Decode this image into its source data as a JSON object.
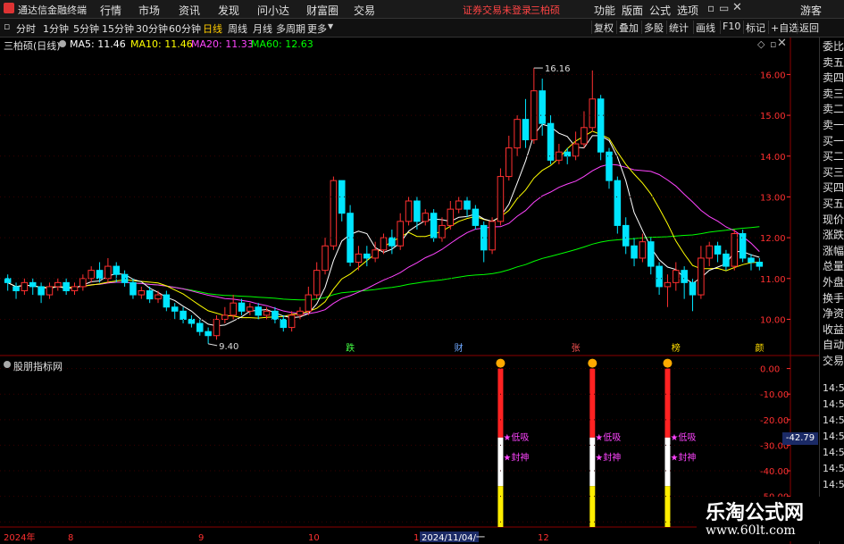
{
  "app": {
    "name": "通达信金融终端"
  },
  "menu": [
    "行情",
    "市场",
    "资讯",
    "发现",
    "问小达",
    "财富圈",
    "交易"
  ],
  "notice": "证券交易未登录",
  "stock_name_top": "三柏硕",
  "top_right": [
    "功能",
    "版面",
    "公式",
    "选项",
    "画线",
    "游客"
  ],
  "timeframes": [
    "分时",
    "1分钟",
    "5分钟",
    "15分钟",
    "30分钟",
    "60分钟",
    "日线",
    "周线",
    "月线",
    "多周期",
    "更多"
  ],
  "active_timeframe": "日线",
  "right_toolbar": [
    "复权",
    "叠加",
    "多股",
    "统计",
    "画线",
    "F10",
    "标记",
    "+自选",
    "返回"
  ],
  "chart_header": {
    "title": "三柏硕(日线)",
    "ma": [
      {
        "label": "MA5: 11.46",
        "color": "#ffffff"
      },
      {
        "label": "MA10: 11.46",
        "color": "#ffff00"
      },
      {
        "label": "MA20: 11.33",
        "color": "#ff44ff"
      },
      {
        "label": "MA60: 12.63",
        "color": "#00ff00"
      }
    ]
  },
  "side_panel": [
    "委比",
    "卖五",
    "卖四",
    "卖三",
    "卖二",
    "卖一",
    "买一",
    "买二",
    "买三",
    "买四",
    "买五",
    "现价",
    "涨跌",
    "涨幅",
    "总量",
    "外盘",
    "换手",
    "净资",
    "收益",
    "自动",
    "交易"
  ],
  "side_times": [
    "14:56",
    "14:56",
    "14:56",
    "14:56",
    "14:56",
    "14:56",
    "14:56"
  ],
  "indicator_title": "股朋指标网",
  "indicator_value": "-42.79",
  "annotations": {
    "high": "16.16",
    "low": "9.40"
  },
  "signal_labels": {
    "buy": "低吸",
    "seal": "封神"
  },
  "event_marks": [
    "跌",
    "财",
    "张",
    "榜",
    "颜"
  ],
  "watermark": {
    "line1": "乐淘公式网",
    "line2": "www.60lt.com"
  },
  "chart_data": {
    "type": "candlestick",
    "y_axis_main": {
      "ticks": [
        16.0,
        15.0,
        14.0,
        13.0,
        12.0,
        11.0,
        10.0
      ],
      "range": [
        9.2,
        16.6
      ]
    },
    "y_axis_indicator": {
      "ticks": [
        0.0,
        -10.0,
        -20.0,
        -30.0,
        -40.0,
        -50.0,
        -60.0
      ],
      "range": [
        -62,
        3
      ]
    },
    "x_labels": [
      "2024年",
      "8",
      "9",
      "10",
      "11",
      "2024/11/04/一",
      "12",
      "1"
    ],
    "candles": [
      [
        11.0,
        10.9,
        11.1,
        10.7
      ],
      [
        10.8,
        10.7,
        10.9,
        10.5
      ],
      [
        10.7,
        10.9,
        11.0,
        10.6
      ],
      [
        10.9,
        10.8,
        11.0,
        10.6
      ],
      [
        10.8,
        10.6,
        10.9,
        10.4
      ],
      [
        10.6,
        10.8,
        10.9,
        10.5
      ],
      [
        10.8,
        10.9,
        11.0,
        10.7
      ],
      [
        10.9,
        10.7,
        11.0,
        10.6
      ],
      [
        10.7,
        10.8,
        10.9,
        10.6
      ],
      [
        10.8,
        11.0,
        11.1,
        10.7
      ],
      [
        11.0,
        11.2,
        11.3,
        10.9
      ],
      [
        11.2,
        11.0,
        11.4,
        10.9
      ],
      [
        11.0,
        11.3,
        11.5,
        10.9
      ],
      [
        11.3,
        11.1,
        11.4,
        10.9
      ],
      [
        11.1,
        10.9,
        11.2,
        10.8
      ],
      [
        10.9,
        10.6,
        11.0,
        10.5
      ],
      [
        10.6,
        10.7,
        10.8,
        10.5
      ],
      [
        10.7,
        10.5,
        10.8,
        10.4
      ],
      [
        10.5,
        10.6,
        10.7,
        10.4
      ],
      [
        10.6,
        10.3,
        10.7,
        10.2
      ],
      [
        10.3,
        10.2,
        10.4,
        10.0
      ],
      [
        10.2,
        10.0,
        10.3,
        9.9
      ],
      [
        10.0,
        9.9,
        10.1,
        9.8
      ],
      [
        9.9,
        9.7,
        10.0,
        9.6
      ],
      [
        9.7,
        9.6,
        9.8,
        9.4
      ],
      [
        9.6,
        10.0,
        10.1,
        9.5
      ],
      [
        10.0,
        10.1,
        10.3,
        9.9
      ],
      [
        10.1,
        10.4,
        10.6,
        10.0
      ],
      [
        10.4,
        10.2,
        10.5,
        10.1
      ],
      [
        10.2,
        10.3,
        10.4,
        10.1
      ],
      [
        10.3,
        10.1,
        10.4,
        10.0
      ],
      [
        10.1,
        10.2,
        10.3,
        10.0
      ],
      [
        10.2,
        10.0,
        10.3,
        9.9
      ],
      [
        10.0,
        9.8,
        10.1,
        9.7
      ],
      [
        9.8,
        10.1,
        10.2,
        9.7
      ],
      [
        10.1,
        10.2,
        10.3,
        10.0
      ],
      [
        10.2,
        10.6,
        10.8,
        10.1
      ],
      [
        10.6,
        11.2,
        11.4,
        10.5
      ],
      [
        11.2,
        11.8,
        12.0,
        11.1
      ],
      [
        11.8,
        13.4,
        13.5,
        11.7
      ],
      [
        13.4,
        12.6,
        13.0,
        12.4
      ],
      [
        12.6,
        11.4,
        12.8,
        11.3
      ],
      [
        11.4,
        11.6,
        11.8,
        11.2
      ],
      [
        11.6,
        11.5,
        11.8,
        11.3
      ],
      [
        11.5,
        11.7,
        11.9,
        11.4
      ],
      [
        11.7,
        12.0,
        12.1,
        11.6
      ],
      [
        12.0,
        11.8,
        12.2,
        11.6
      ],
      [
        11.8,
        12.4,
        12.6,
        11.7
      ],
      [
        12.4,
        12.9,
        13.0,
        12.3
      ],
      [
        12.9,
        12.4,
        13.0,
        12.2
      ],
      [
        12.4,
        12.6,
        12.7,
        12.3
      ],
      [
        12.6,
        12.0,
        12.7,
        11.9
      ],
      [
        12.0,
        12.3,
        12.5,
        11.9
      ],
      [
        12.3,
        12.7,
        12.9,
        12.2
      ],
      [
        12.7,
        12.9,
        13.0,
        12.6
      ],
      [
        12.9,
        12.7,
        13.0,
        12.5
      ],
      [
        12.7,
        12.3,
        12.8,
        12.2
      ],
      [
        12.3,
        11.7,
        12.4,
        11.4
      ],
      [
        11.7,
        12.4,
        12.5,
        11.6
      ],
      [
        12.4,
        13.5,
        13.7,
        12.3
      ],
      [
        13.5,
        14.2,
        14.5,
        13.4
      ],
      [
        14.2,
        14.9,
        15.0,
        14.0
      ],
      [
        14.9,
        14.4,
        15.4,
        14.2
      ],
      [
        14.4,
        15.6,
        16.16,
        14.3
      ],
      [
        15.6,
        14.8,
        15.9,
        14.5
      ],
      [
        14.8,
        13.9,
        15.0,
        13.8
      ],
      [
        13.9,
        14.1,
        14.3,
        13.8
      ],
      [
        14.1,
        14.0,
        14.2,
        13.8
      ],
      [
        14.0,
        14.3,
        14.6,
        13.9
      ],
      [
        14.3,
        14.7,
        15.1,
        14.2
      ],
      [
        14.7,
        15.4,
        16.1,
        14.6
      ],
      [
        15.4,
        14.1,
        15.5,
        13.9
      ],
      [
        14.1,
        13.4,
        14.2,
        13.2
      ],
      [
        13.4,
        12.3,
        13.5,
        12.1
      ],
      [
        12.3,
        11.8,
        12.5,
        11.6
      ],
      [
        11.8,
        11.5,
        12.0,
        11.3
      ],
      [
        11.5,
        11.9,
        12.1,
        11.4
      ],
      [
        11.9,
        11.3,
        12.0,
        11.1
      ],
      [
        11.3,
        10.8,
        11.4,
        10.6
      ],
      [
        10.8,
        10.9,
        11.1,
        10.3
      ],
      [
        10.9,
        11.2,
        11.4,
        10.7
      ],
      [
        11.2,
        10.9,
        11.3,
        10.5
      ],
      [
        10.9,
        10.6,
        11.0,
        10.2
      ],
      [
        10.6,
        11.5,
        11.8,
        10.5
      ],
      [
        11.5,
        11.8,
        11.9,
        11.3
      ],
      [
        11.8,
        11.6,
        11.9,
        11.4
      ],
      [
        11.6,
        11.3,
        11.7,
        11.2
      ],
      [
        11.3,
        12.1,
        12.2,
        11.2
      ],
      [
        12.1,
        11.5,
        12.2,
        11.4
      ],
      [
        11.5,
        11.4,
        11.6,
        11.2
      ],
      [
        11.4,
        11.3,
        11.5,
        11.2
      ]
    ],
    "ma_color_key": {
      "MA5": "#ffffff",
      "MA10": "#ffff00",
      "MA20": "#ff44ff",
      "MA60": "#00ff00"
    },
    "indicator_bars": [
      {
        "candle_index": 59,
        "color_top": "#ff2222",
        "mid": "#ffffff",
        "bottom": "#ffee00"
      },
      {
        "candle_index": 70,
        "color_top": "#ff2222",
        "mid": "#ffffff",
        "bottom": "#ffee00"
      },
      {
        "candle_index": 79,
        "color_top": "#ff2222",
        "mid": "#ffffff",
        "bottom": "#ffee00"
      }
    ]
  },
  "colors": {
    "up": "#ff3030",
    "down": "#00e5ff",
    "grid": "#8b0000",
    "axis_text": "#ff3030"
  }
}
